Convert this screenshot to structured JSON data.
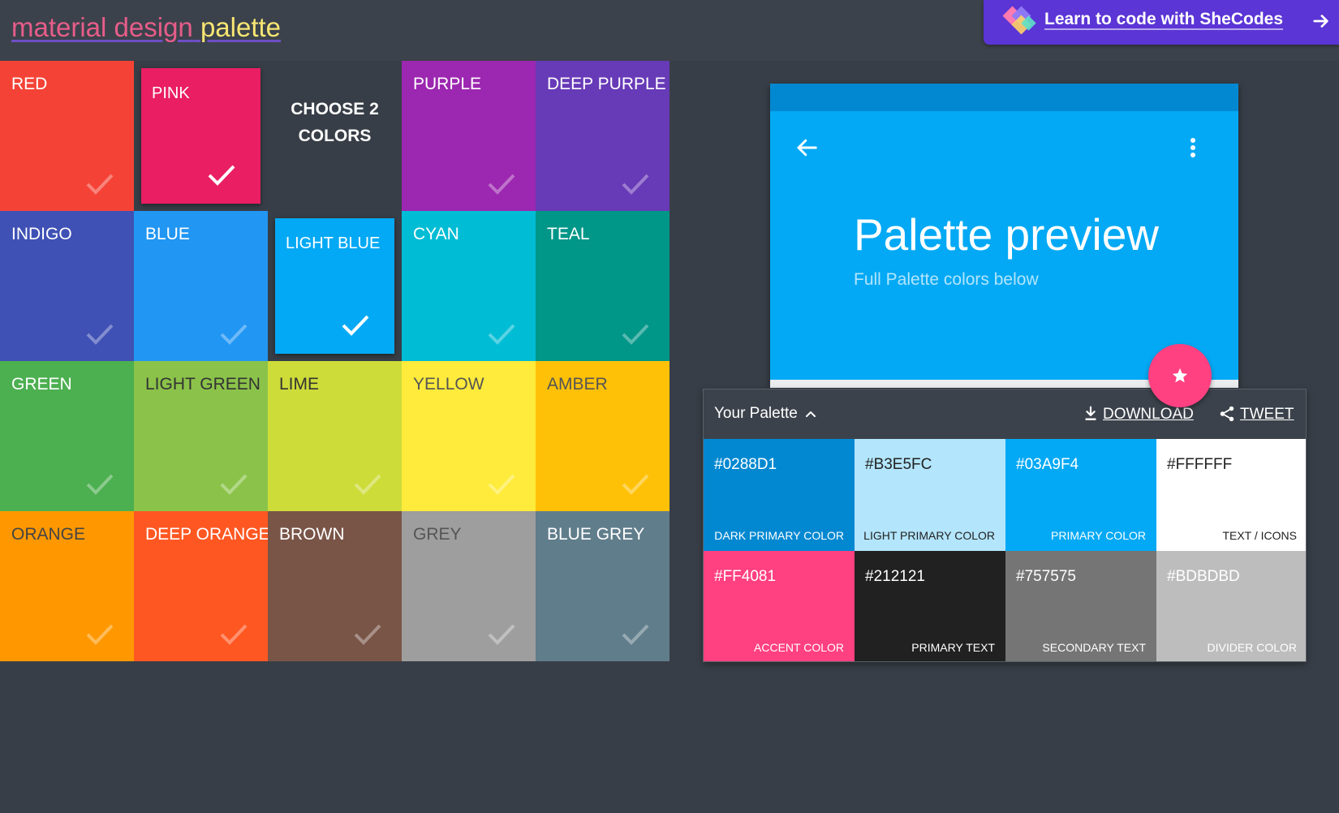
{
  "header": {
    "logo_part1": "material design",
    "logo_part2": "palette",
    "promo_text": "Learn to code with SheCodes",
    "promo_bg": "#5b35d5"
  },
  "grid": {
    "prompt": "CHOOSE 2\nCOLORS",
    "colors": [
      {
        "name": "RED",
        "hex": "#f44336",
        "text": "#ffffff",
        "selected": false
      },
      {
        "name": "PINK",
        "hex": "#e91e63",
        "text": "#ffffff",
        "selected": true
      },
      {
        "name": "PURPLE",
        "hex": "#9c27b0",
        "text": "#ffffff",
        "selected": false
      },
      {
        "name": "DEEP PURPLE",
        "hex": "#673ab7",
        "text": "#ffffff",
        "selected": false
      },
      {
        "name": "INDIGO",
        "hex": "#3f51b5",
        "text": "#ffffff",
        "selected": false
      },
      {
        "name": "BLUE",
        "hex": "#2196f3",
        "text": "#ffffff",
        "selected": false
      },
      {
        "name": "LIGHT BLUE",
        "hex": "#03a9f4",
        "text": "#ffffff",
        "selected": true
      },
      {
        "name": "CYAN",
        "hex": "#00bcd4",
        "text": "#ffffff",
        "selected": false
      },
      {
        "name": "TEAL",
        "hex": "#009688",
        "text": "#ffffff",
        "selected": false
      },
      {
        "name": "GREEN",
        "hex": "#4caf50",
        "text": "#ffffff",
        "selected": false
      },
      {
        "name": "LIGHT GREEN",
        "hex": "#8bc34a",
        "text": "#333333",
        "selected": false
      },
      {
        "name": "LIME",
        "hex": "#cddc39",
        "text": "#333333",
        "selected": false
      },
      {
        "name": "YELLOW",
        "hex": "#ffeb3b",
        "text": "#555555",
        "selected": false
      },
      {
        "name": "AMBER",
        "hex": "#ffc107",
        "text": "#555555",
        "selected": false
      },
      {
        "name": "ORANGE",
        "hex": "#ff9800",
        "text": "#444444",
        "selected": false
      },
      {
        "name": "DEEP ORANGE",
        "hex": "#ff5722",
        "text": "#ffffff",
        "selected": false
      },
      {
        "name": "BROWN",
        "hex": "#795548",
        "text": "#ffffff",
        "selected": false
      },
      {
        "name": "GREY",
        "hex": "#9e9e9e",
        "text": "#555555",
        "selected": false
      },
      {
        "name": "BLUE GREY",
        "hex": "#607d8b",
        "text": "#ffffff",
        "selected": false
      }
    ]
  },
  "preview": {
    "title": "Palette preview",
    "subtitle": "Full Palette colors below",
    "statusbar_color": "#0288d1",
    "appbar_color": "#03a9f4",
    "fab_color": "#ff4081",
    "back_icon": "arrow-back-icon",
    "menu_icon": "more-vert-icon",
    "fab_icon": "star-icon"
  },
  "palette": {
    "title": "Your Palette",
    "download_label": "DOWNLOAD",
    "tweet_label": "TWEET",
    "swatches": [
      {
        "hex": "#0288D1",
        "label": "DARK PRIMARY COLOR",
        "bg": "#0288d1",
        "fg": "#ffffff"
      },
      {
        "hex": "#B3E5FC",
        "label": "LIGHT PRIMARY COLOR",
        "bg": "#b3e5fc",
        "fg": "#212121"
      },
      {
        "hex": "#03A9F4",
        "label": "PRIMARY COLOR",
        "bg": "#03a9f4",
        "fg": "#ffffff"
      },
      {
        "hex": "#FFFFFF",
        "label": "TEXT / ICONS",
        "bg": "#ffffff",
        "fg": "#212121"
      },
      {
        "hex": "#FF4081",
        "label": "ACCENT COLOR",
        "bg": "#ff4081",
        "fg": "#ffffff"
      },
      {
        "hex": "#212121",
        "label": "PRIMARY TEXT",
        "bg": "#212121",
        "fg": "#ffffff"
      },
      {
        "hex": "#757575",
        "label": "SECONDARY TEXT",
        "bg": "#757575",
        "fg": "#ffffff"
      },
      {
        "hex": "#BDBDBD",
        "label": "DIVIDER COLOR",
        "bg": "#bdbdbd",
        "fg": "#ffffff"
      }
    ]
  }
}
